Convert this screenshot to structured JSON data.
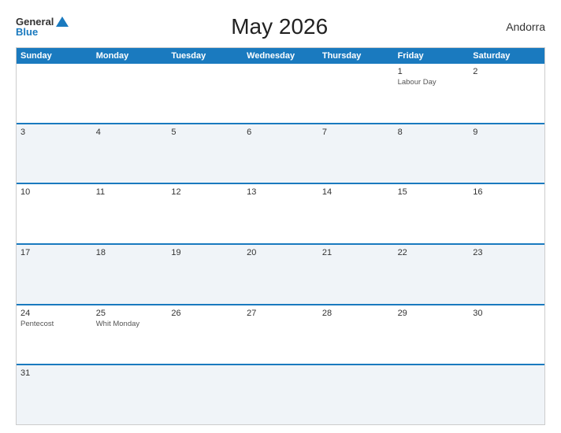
{
  "header": {
    "logo_general": "General",
    "logo_blue": "Blue",
    "title": "May 2026",
    "region": "Andorra"
  },
  "days_of_week": [
    "Sunday",
    "Monday",
    "Tuesday",
    "Wednesday",
    "Thursday",
    "Friday",
    "Saturday"
  ],
  "weeks": [
    [
      {
        "day": "",
        "holiday": ""
      },
      {
        "day": "",
        "holiday": ""
      },
      {
        "day": "",
        "holiday": ""
      },
      {
        "day": "",
        "holiday": ""
      },
      {
        "day": "",
        "holiday": ""
      },
      {
        "day": "1",
        "holiday": "Labour Day"
      },
      {
        "day": "2",
        "holiday": ""
      }
    ],
    [
      {
        "day": "3",
        "holiday": ""
      },
      {
        "day": "4",
        "holiday": ""
      },
      {
        "day": "5",
        "holiday": ""
      },
      {
        "day": "6",
        "holiday": ""
      },
      {
        "day": "7",
        "holiday": ""
      },
      {
        "day": "8",
        "holiday": ""
      },
      {
        "day": "9",
        "holiday": ""
      }
    ],
    [
      {
        "day": "10",
        "holiday": ""
      },
      {
        "day": "11",
        "holiday": ""
      },
      {
        "day": "12",
        "holiday": ""
      },
      {
        "day": "13",
        "holiday": ""
      },
      {
        "day": "14",
        "holiday": ""
      },
      {
        "day": "15",
        "holiday": ""
      },
      {
        "day": "16",
        "holiday": ""
      }
    ],
    [
      {
        "day": "17",
        "holiday": ""
      },
      {
        "day": "18",
        "holiday": ""
      },
      {
        "day": "19",
        "holiday": ""
      },
      {
        "day": "20",
        "holiday": ""
      },
      {
        "day": "21",
        "holiday": ""
      },
      {
        "day": "22",
        "holiday": ""
      },
      {
        "day": "23",
        "holiday": ""
      }
    ],
    [
      {
        "day": "24",
        "holiday": "Pentecost"
      },
      {
        "day": "25",
        "holiday": "Whit Monday"
      },
      {
        "day": "26",
        "holiday": ""
      },
      {
        "day": "27",
        "holiday": ""
      },
      {
        "day": "28",
        "holiday": ""
      },
      {
        "day": "29",
        "holiday": ""
      },
      {
        "day": "30",
        "holiday": ""
      }
    ],
    [
      {
        "day": "31",
        "holiday": ""
      },
      {
        "day": "",
        "holiday": ""
      },
      {
        "day": "",
        "holiday": ""
      },
      {
        "day": "",
        "holiday": ""
      },
      {
        "day": "",
        "holiday": ""
      },
      {
        "day": "",
        "holiday": ""
      },
      {
        "day": "",
        "holiday": ""
      }
    ]
  ]
}
